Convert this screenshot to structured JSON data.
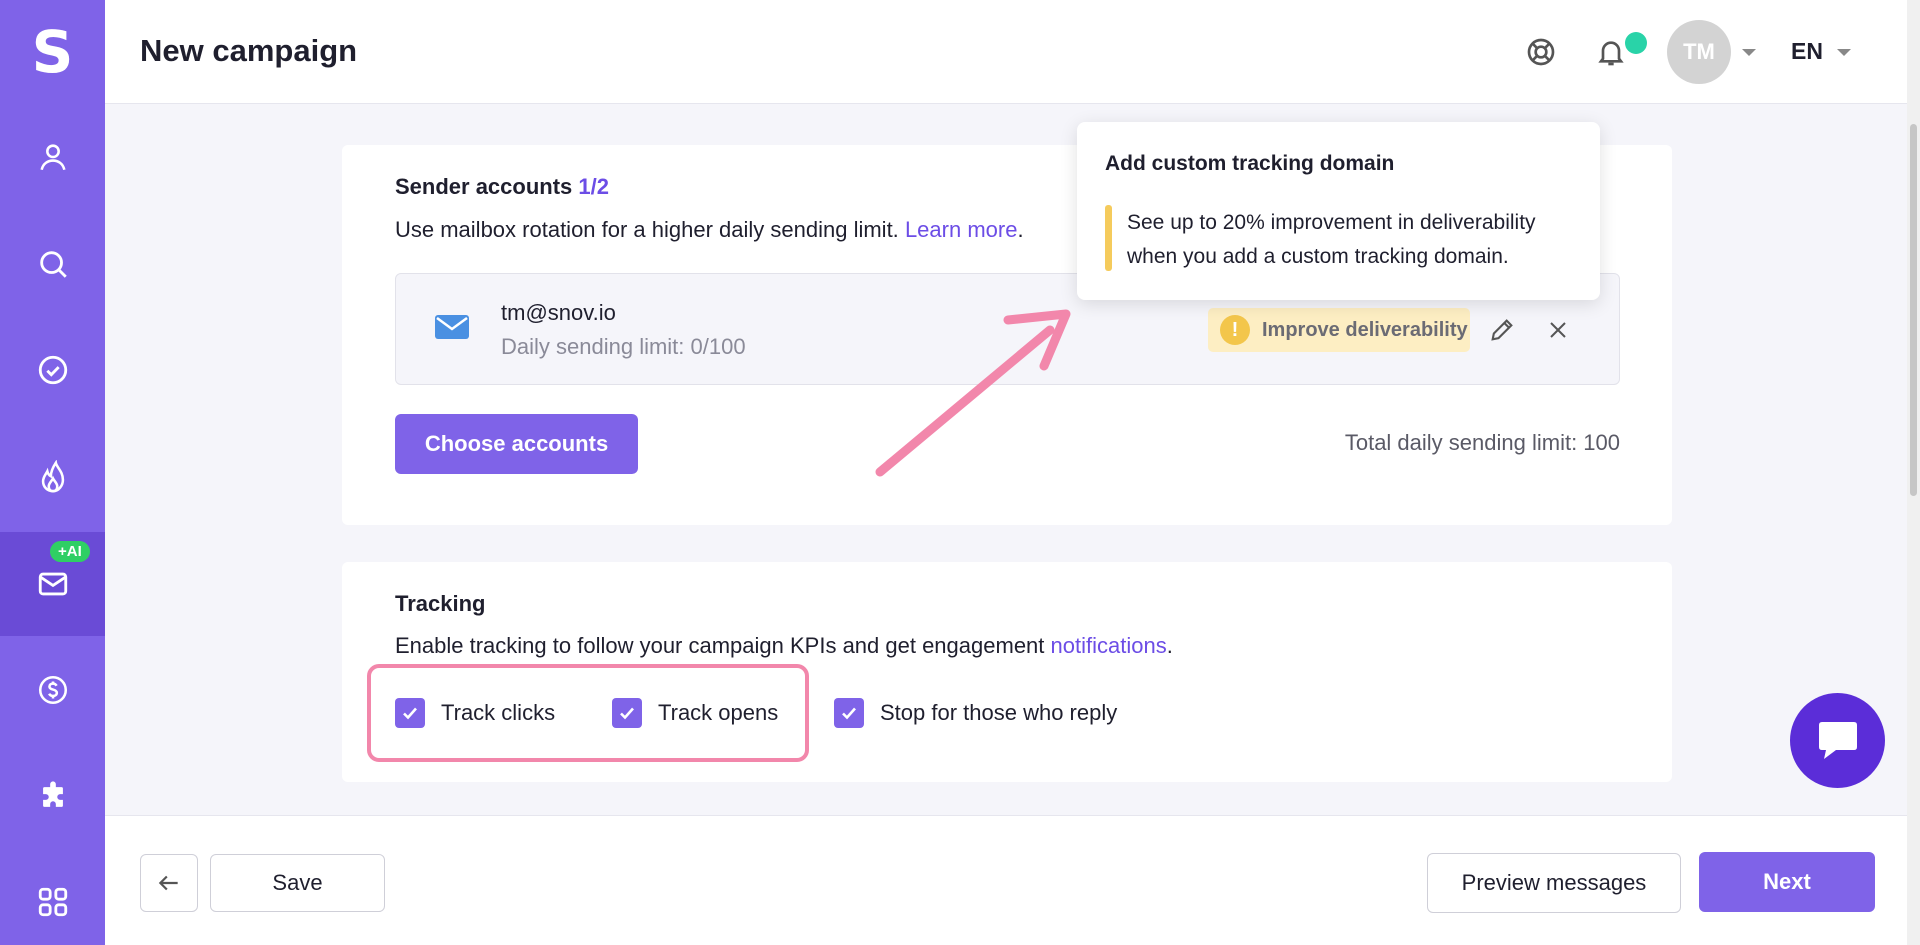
{
  "app": {
    "logo_letter": "S"
  },
  "sidebar": {
    "items": [
      {
        "name": "contacts",
        "icon": "user-icon"
      },
      {
        "name": "search",
        "icon": "search-icon"
      },
      {
        "name": "verify",
        "icon": "check-circle-icon"
      },
      {
        "name": "warmup",
        "icon": "flame-icon"
      },
      {
        "name": "campaigns",
        "icon": "mail-icon",
        "active": true,
        "badge": "+AI"
      },
      {
        "name": "billing",
        "icon": "dollar-icon"
      },
      {
        "name": "integrations",
        "icon": "puzzle-icon"
      },
      {
        "name": "apps",
        "icon": "grid-icon"
      }
    ]
  },
  "header": {
    "title": "New campaign",
    "avatar_initials": "TM",
    "language": "EN"
  },
  "sender": {
    "title": "Sender accounts",
    "count": "1/2",
    "description": "Use mailbox rotation for a higher daily sending limit.",
    "learn_more": "Learn more",
    "period": ".",
    "account": {
      "email": "tm@snov.io",
      "limit": "Daily sending limit: 0/100",
      "improve_label": "Improve deliverability"
    },
    "choose_button": "Choose accounts",
    "total_limit": "Total daily sending limit: 100"
  },
  "tooltip": {
    "title": "Add custom tracking domain",
    "text": "See up to 20% improvement in deliverability when you add a custom tracking domain."
  },
  "tracking": {
    "title": "Tracking",
    "description": "Enable tracking to follow your campaign KPIs and get engagement",
    "link": "notifications",
    "period": ".",
    "options": [
      {
        "label": "Track clicks",
        "checked": true
      },
      {
        "label": "Track opens",
        "checked": true
      },
      {
        "label": "Stop for those who reply",
        "checked": true
      }
    ]
  },
  "footer": {
    "save": "Save",
    "preview": "Preview messages",
    "next": "Next"
  },
  "colors": {
    "brand": "#7f63e8",
    "accent_link": "#6c4de6",
    "highlight": "#f287ab",
    "notification_dot": "#29d3a8"
  }
}
